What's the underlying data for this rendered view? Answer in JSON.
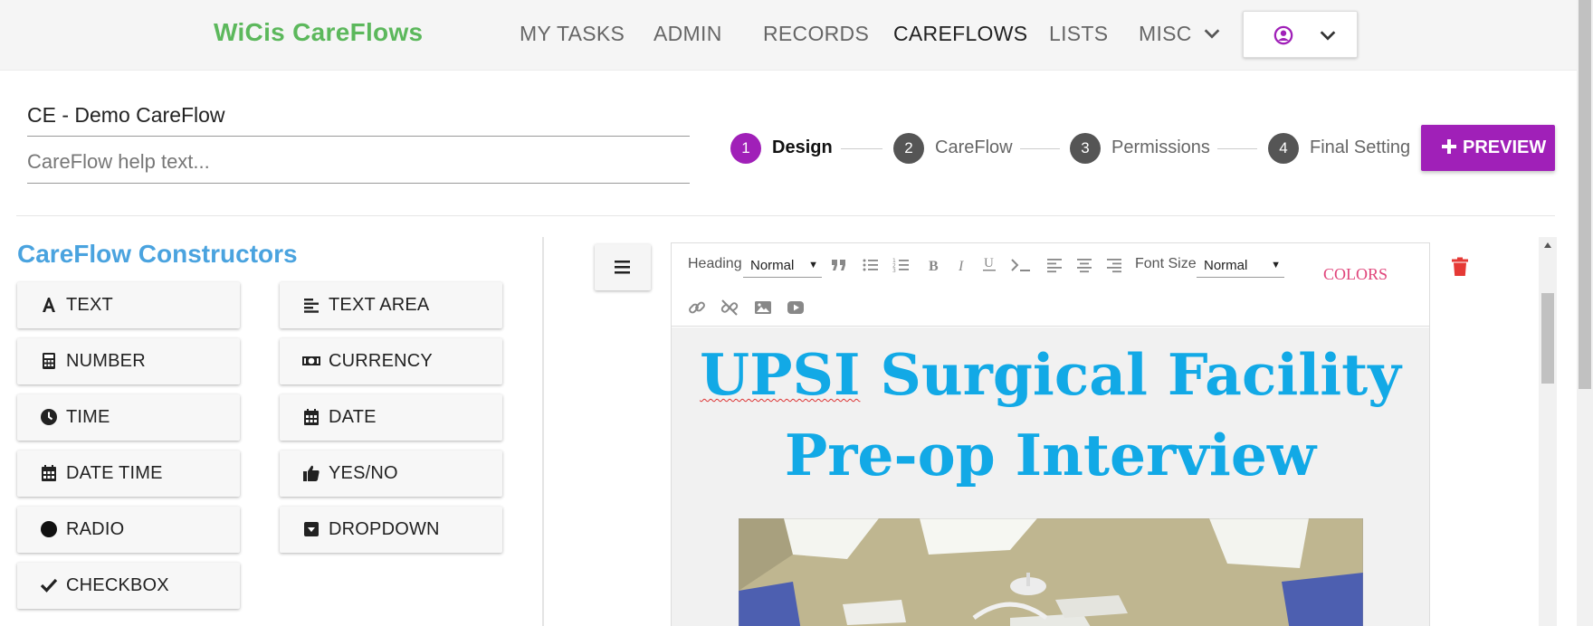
{
  "navbar": {
    "brand": "WiCis CareFlows",
    "items": [
      "MY TASKS",
      "ADMIN",
      "RECORDS",
      "CAREFLOWS",
      "LISTS",
      "MISC"
    ],
    "active_item": "CAREFLOWS"
  },
  "careflow": {
    "title": "CE - Demo CareFlow",
    "help_placeholder": "CareFlow help text..."
  },
  "stepper": {
    "steps": [
      {
        "num": "1",
        "label": "Design",
        "active": true
      },
      {
        "num": "2",
        "label": "CareFlow",
        "active": false
      },
      {
        "num": "3",
        "label": "Permissions",
        "active": false
      },
      {
        "num": "4",
        "label": "Final Setting",
        "active": false
      }
    ],
    "preview_label": "PREVIEW"
  },
  "constructors": {
    "title": "CareFlow Constructors",
    "buttons": [
      {
        "label": "TEXT",
        "icon": "text-icon"
      },
      {
        "label": "TEXT AREA",
        "icon": "align-left-icon"
      },
      {
        "label": "NUMBER",
        "icon": "calculator-icon"
      },
      {
        "label": "CURRENCY",
        "icon": "money-icon"
      },
      {
        "label": "TIME",
        "icon": "clock-icon"
      },
      {
        "label": "DATE",
        "icon": "calendar-icon"
      },
      {
        "label": "DATE TIME",
        "icon": "calendar-icon"
      },
      {
        "label": "YES/NO",
        "icon": "thumbs-up-icon"
      },
      {
        "label": "RADIO",
        "icon": "circle-icon"
      },
      {
        "label": "DROPDOWN",
        "icon": "caret-square-down-icon"
      },
      {
        "label": "CHECKBOX",
        "icon": "check-icon"
      }
    ]
  },
  "toolbar": {
    "heading_label": "Heading",
    "heading_value": "Normal",
    "font_size_label": "Font Size",
    "font_size_value": "Normal",
    "colors_label": "COLORS"
  },
  "editor": {
    "heading_line1_word1": "UPSI",
    "heading_line1_rest": "Surgical Facility",
    "heading_line2": "Pre-op Interview",
    "heading_color": "#12a9e6"
  },
  "colors": {
    "brand": "#5cb85c",
    "accent": "#a020b8",
    "section_title": "#4aa3df",
    "delete": "#e53935"
  }
}
